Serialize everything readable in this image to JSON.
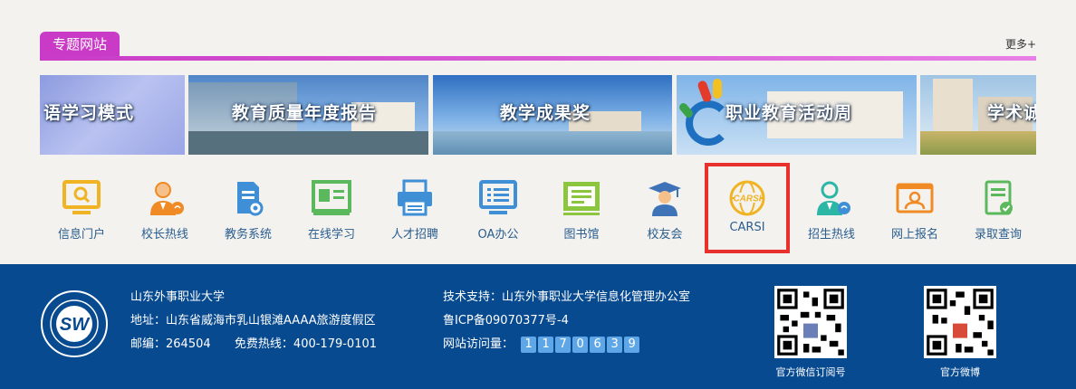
{
  "section": {
    "title": "专题网站",
    "more": "更多+"
  },
  "banners": [
    {
      "label": "语学习模式"
    },
    {
      "label": "教育质量年度报告"
    },
    {
      "label": "教学成果奖"
    },
    {
      "label": "职业教育活动周"
    },
    {
      "label": "学术诚"
    }
  ],
  "quick_links": [
    {
      "label": "信息门户",
      "icon": "monitor-search-icon",
      "color": "#f0b323"
    },
    {
      "label": "校长热线",
      "icon": "person-headset-icon",
      "color": "#f08a24"
    },
    {
      "label": "教务系统",
      "icon": "document-gear-icon",
      "color": "#3f8fd6"
    },
    {
      "label": "在线学习",
      "icon": "screen-card-icon",
      "color": "#5cb85c"
    },
    {
      "label": "人才招聘",
      "icon": "printer-icon",
      "color": "#3f8fd6"
    },
    {
      "label": "OA办公",
      "icon": "monitor-list-icon",
      "color": "#3f8fd6"
    },
    {
      "label": "图书馆",
      "icon": "library-screen-icon",
      "color": "#8cc63f"
    },
    {
      "label": "校友会",
      "icon": "graduate-icon",
      "color": "#3f73b8"
    },
    {
      "label": "CARSI",
      "icon": "carsi-globe-icon",
      "color": "#f0b323"
    },
    {
      "label": "招生热线",
      "icon": "person-phone-icon",
      "color": "#2bb6a6"
    },
    {
      "label": "网上报名",
      "icon": "id-card-icon",
      "color": "#f08a24"
    },
    {
      "label": "录取查询",
      "icon": "document-check-icon",
      "color": "#5cb85c"
    }
  ],
  "footer": {
    "school_name": "山东外事职业大学",
    "address": "地址：山东省威海市乳山银滩AAAA旅游度假区",
    "postcode": "邮编：264504",
    "hotline": "免费热线：400-179-0101",
    "tech_support": "技术支持：山东外事职业大学信息化管理办公室",
    "icp": "鲁ICP备09070377号-4",
    "visits_label": "网站访问量：",
    "visit_digits": [
      "1",
      "1",
      "7",
      "0",
      "6",
      "3",
      "9"
    ],
    "qr1_label": "官方微信订阅号",
    "qr2_label": "官方微博",
    "logo_text": "SW"
  },
  "colors": {
    "accent": "#c93bc6",
    "footer_bg": "#074a90",
    "link_text": "#2a5d8f",
    "highlight": "#e8302c"
  }
}
